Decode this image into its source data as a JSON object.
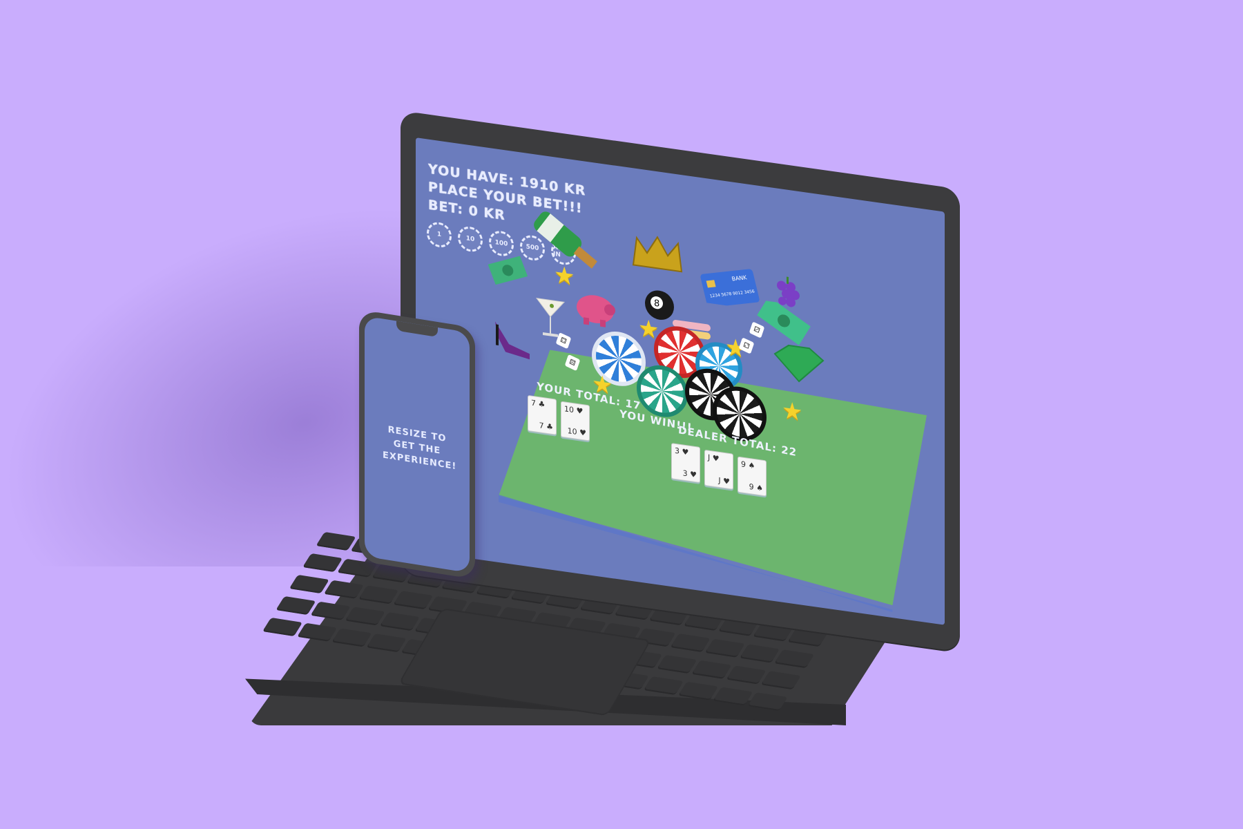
{
  "game": {
    "hud": {
      "balance_text": "YOU HAVE: 1910 KR",
      "prompt_text": "PLACE YOUR BET!!!",
      "bet_text": "BET: 0 KR"
    },
    "chip_buttons": [
      {
        "label": "1"
      },
      {
        "label": "10"
      },
      {
        "label": "100"
      },
      {
        "label": "500"
      },
      {
        "label": "ALL IN"
      }
    ],
    "player": {
      "total_text": "YOUR TOTAL: 17",
      "cards": [
        {
          "rank": "7",
          "suit": "♣"
        },
        {
          "rank": "10",
          "suit": "♥"
        }
      ]
    },
    "result_text": "YOU WIN!!!",
    "dealer": {
      "total_text": "DEALER TOTAL: 22",
      "cards": [
        {
          "rank": "3",
          "suit": "♥"
        },
        {
          "rank": "J",
          "suit": "♥"
        },
        {
          "rank": "9",
          "suit": "♠"
        }
      ]
    },
    "decor": {
      "eight_ball_text": "8",
      "card_brand_text": "BANK",
      "card_number_text": "1234 5678 9012 3456"
    }
  },
  "phone": {
    "message": "RESIZE TO GET THE EXPERIENCE!"
  },
  "colors": {
    "background": "#c9adfd",
    "screen": "#6b7cbd",
    "table": "#6cb56e",
    "device": "#3c3c3e"
  }
}
